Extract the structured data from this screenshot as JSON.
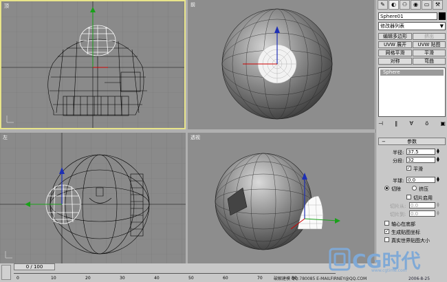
{
  "viewports": {
    "top_label": "顶",
    "front_label": "前",
    "left_label": "左",
    "persp_label": "透视"
  },
  "panel": {
    "object_name": "Sphere01",
    "modifier_list": "修改器列表",
    "buttons": {
      "edit_poly": "编辑多边形",
      "extrude": "挤出",
      "uvw_unwrap": "UVW 展开",
      "uvw_map": "UVW 贴图",
      "meshsmooth": "网格平滑",
      "smooth": "平滑",
      "symmetry": "对称",
      "bend": "弯曲"
    },
    "stack_item": "Sphere",
    "params_title": "参数",
    "radius_label": "半径:",
    "radius_value": "37.5",
    "segments_label": "分段:",
    "segments_value": "32",
    "smooth_label": "平滑",
    "hemisphere_label": "半球:",
    "hemisphere_value": "0.0",
    "chop_label": "切除",
    "squash_label": "挤压",
    "slice_on_label": "切片启用",
    "slice_from_label": "切片从:",
    "slice_from_value": "0.0",
    "slice_to_label": "切片到:",
    "slice_to_value": "0.0",
    "base_pivot_label": "轴心在底部",
    "gen_map_label": "生成贴图坐标",
    "real_world_label": "真实世界贴图大小"
  },
  "timeline": {
    "frame_display": "0 / 100",
    "ticks": [
      "0",
      "10",
      "20",
      "30",
      "40",
      "50",
      "60",
      "70",
      "80"
    ]
  },
  "brand": {
    "logo": "CG时代",
    "url": "www.cgtime.com",
    "date": "2006-8-25",
    "credit": "破解建模 QQ:780085 E-MAILFIRNEY@QQ.COM"
  }
}
